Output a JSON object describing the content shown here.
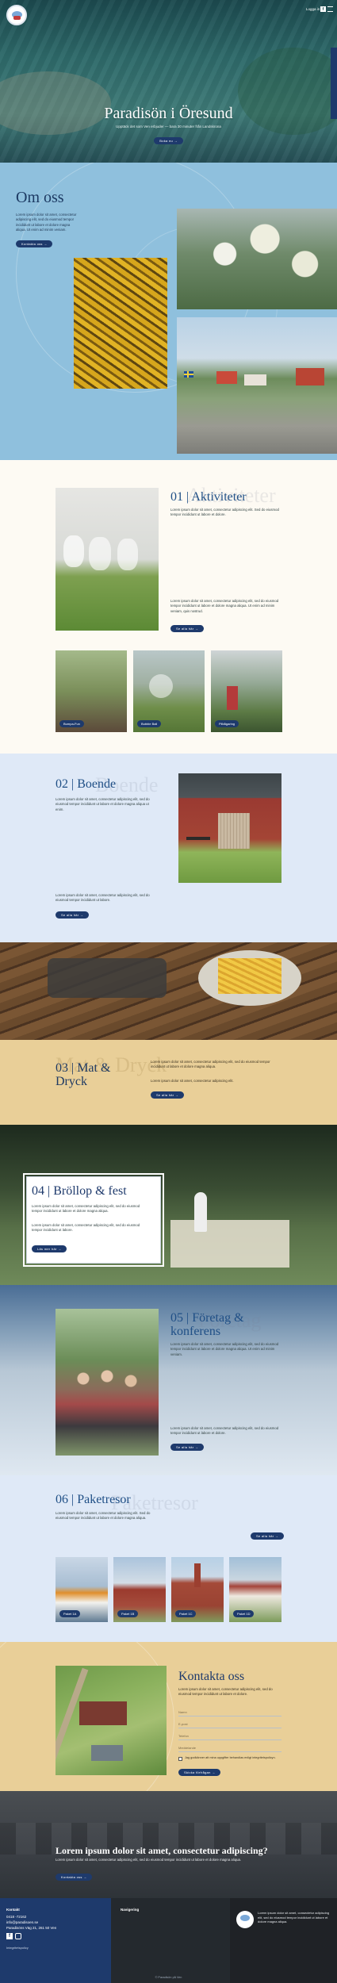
{
  "header": {
    "login": "Logga in",
    "facebook_icon": "facebook-icon"
  },
  "hero": {
    "title": "Paradisön i Öresund",
    "subtitle": "Upptäck det som Ven erbjuder — bara 30 minuter från Landskrona",
    "button": "Boka nu",
    "side_tab": "Bokningsförfrågan"
  },
  "om_oss": {
    "title": "Om oss",
    "text": "Lorem ipsum dolor sit amet, consectetur adipiscing elit, sed do eiusmod tempor incididunt ut labore et dolore magna aliqua. Ut enim ad minim veniam.",
    "button": "Kontakta oss"
  },
  "aktiviteter": {
    "title": "01 | Aktiviteter",
    "ghost": "Aktiviteter",
    "text1": "Lorem ipsum dolor sit amet, consectetur adipiscing elit. Sed do eiusmod tempor incididunt ut labore et dolore.",
    "text2": "Lorem ipsum dolor sit amet, consectetur adipiscing elit, sed do eiusmod tempor incididunt ut labore et dolore magna aliqua. Ut enim ad minim veniam, quis nostrud.",
    "button": "Se alla här",
    "cards": [
      "Bumpa-Fun",
      "Bubble Ball",
      "Pilbågaring"
    ]
  },
  "boende": {
    "title": "02 | Boende",
    "ghost": "Boende",
    "text1": "Lorem ipsum dolor sit amet, consectetur adipiscing elit, sed do eiusmod tempor incididunt ut labore et dolore magna aliqua ut enim.",
    "text2": "Lorem ipsum dolor sit amet, consectetur adipiscing elit, sed do eiusmod tempor incididunt ut labore.",
    "button": "Se alla här"
  },
  "mat": {
    "title": "03 | Mat & Dryck",
    "ghost": "Mat & Dryck",
    "text1": "Lorem ipsum dolor sit amet, consectetur adipiscing elit, sed do eiusmod tempor incididunt ut labore et dolore magna aliqua.",
    "text2": "Lorem ipsum dolor sit amet, consectetur adipiscing elit.",
    "button": "Se alla här"
  },
  "brollop": {
    "title": "04 | Bröllop & fest",
    "text1": "Lorem ipsum dolor sit amet, consectetur adipiscing elit, sed do eiusmod tempor incididunt ut labore et dolore magna aliqua.",
    "text2": "Lorem ipsum dolor sit amet, consectetur adipiscing elit, sed do eiusmod tempor incididunt ut labore.",
    "button": "Läs mer här"
  },
  "foretag": {
    "title": "05 | Företag & konferens",
    "ghost": "Företag",
    "text1": "Lorem ipsum dolor sit amet, consectetur adipiscing elit, sed do eiusmod tempor incididunt ut labore et dolore magna aliqua. Ut enim ad minim veniam.",
    "text2": "Lorem ipsum dolor sit amet, consectetur adipiscing elit, sed do eiusmod tempor incididunt ut labore et dolore.",
    "button": "Se alla här"
  },
  "paket": {
    "title": "06 | Paketresor",
    "ghost": "Paketresor",
    "text": "Lorem ipsum dolor sit amet, consectetur adipiscing elit. Sed do eiusmod tempor incididunt ut labore et dolore magna aliqua.",
    "button": "Se alla här",
    "cards": [
      "Paket 1A",
      "Paket 1B",
      "Paket 1C",
      "Paket 1D"
    ]
  },
  "kontakt": {
    "title": "Kontakta oss",
    "text": "Lorem ipsum dolor sit amet, consectetur adipiscing elit, sed do eiusmod tempor incididunt ut labore et dolore.",
    "fields": [
      "Namn",
      "E-post",
      "Telefon",
      "Meddelande"
    ],
    "consent": "Jag godkänner att mina uppgifter behandlas enligt integritetspolicyn.",
    "button": "Skicka förfrågan"
  },
  "cta": {
    "title": "Lorem ipsum dolor sit amet, consectetur adipiscing?",
    "text": "Lorem ipsum dolor sit amet, consectetur adipiscing elit, sed do eiusmod tempor incididunt ut labore et dolore magna aliqua.",
    "button": "Kontakta oss"
  },
  "footer": {
    "col1_title": "Kontakt",
    "phone": "0418 -72162",
    "email": "info@paradisoen.se",
    "address": "Paradisöns Väg 21, 261 50 Ven",
    "col2_title": "Navigering",
    "link": "Integritetspolicy",
    "about": "Lorem ipsum dolor sit amet, consectetur adipiscing elit, sed do eiusmod tempor incididunt ut labore et dolore magna aliqua.",
    "copyright": "© Paradisön på Ven"
  },
  "colors": {
    "navy": "#1e3a6c",
    "sky": "#8fc0dd",
    "sand": "#e9cf98",
    "light_blue": "#dfe9f7"
  }
}
